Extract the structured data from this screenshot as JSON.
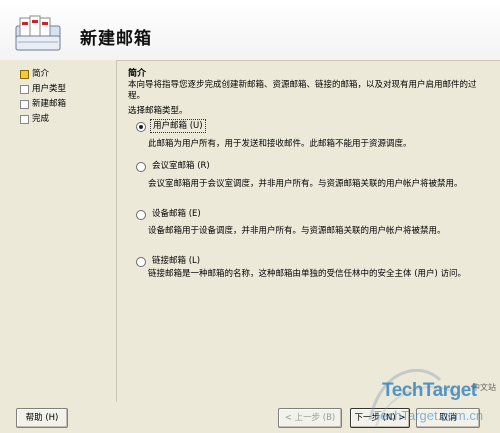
{
  "header": {
    "title": "新建邮箱"
  },
  "sidebar": {
    "steps": [
      {
        "label": "简介"
      },
      {
        "label": "用户类型"
      },
      {
        "label": "新建邮箱"
      },
      {
        "label": "完成"
      }
    ]
  },
  "content": {
    "section_title": "简介",
    "intro": "本向导将指导您逐步完成创建新邮箱、资源邮箱、链接的邮箱，以及对现有用户启用邮件的过程。",
    "prompt": "选择邮箱类型。",
    "options": [
      {
        "label": "用户邮箱 (U)",
        "checked": true,
        "description": "此邮箱为用户所有，用于发送和接收邮件。此邮箱不能用于资源调度。"
      },
      {
        "label": "会议室邮箱 (R)",
        "checked": false,
        "description": "会议室邮箱用于会议室调度，并非用户所有。与资源邮箱关联的用户帐户将被禁用。"
      },
      {
        "label": "设备邮箱 (E)",
        "checked": false,
        "description": "设备邮箱用于设备调度，并非用户所有。与资源邮箱关联的用户帐户将被禁用。"
      },
      {
        "label": "链接邮箱 (L)",
        "checked": false,
        "description": "链接邮箱是一种邮箱的名称，这种邮箱由单独的受信任林中的安全主体 (用户) 访问。"
      }
    ]
  },
  "buttons": {
    "help": "帮助 (H)",
    "back": "< 上一步 (B)",
    "next": "下一步 (N) >",
    "cancel": "取消"
  },
  "watermark": {
    "brand": "TechTarget",
    "cn": "中文站",
    "url": "TechTarget.com.cn"
  }
}
